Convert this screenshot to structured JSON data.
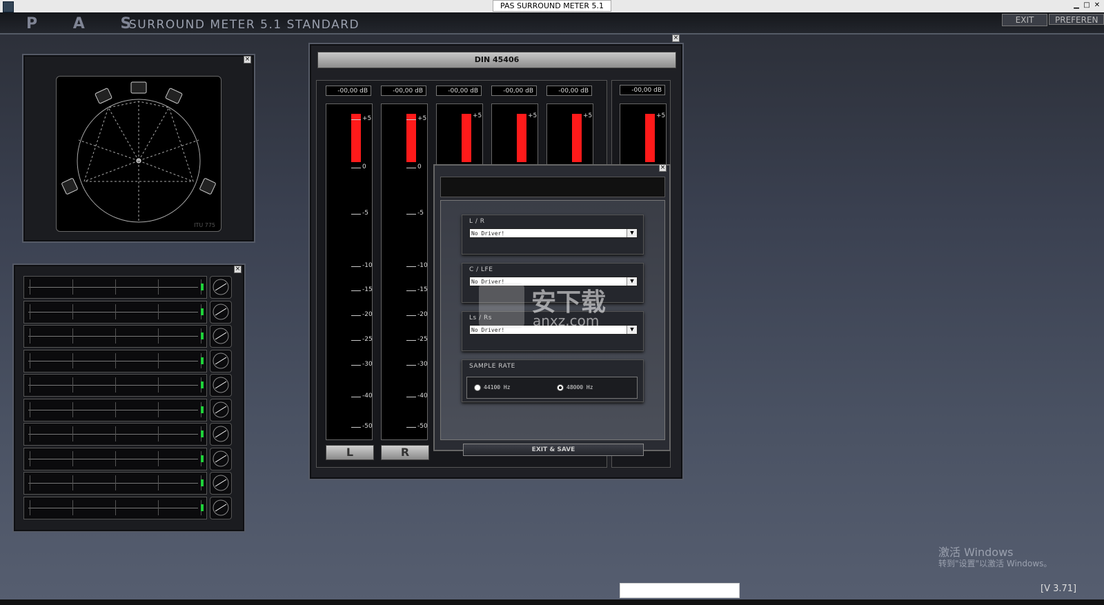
{
  "window": {
    "title": "PAS SURROUND METER 5.1"
  },
  "header": {
    "logo": "P A S",
    "product": "SURROUND METER  5.1 STANDARD",
    "exit_label": "EXIT",
    "preferences_label": "PREFEREN"
  },
  "speaker_panel": {
    "label": "ITU 775"
  },
  "meter_panel": {
    "standard": "DIN 45406",
    "readouts": [
      "-00,00 dB",
      "-00,00 dB",
      "-00,00 dB",
      "-00,00 dB",
      "-00,00 dB",
      "-00,00 dB"
    ],
    "scale_labels": [
      "+5",
      "0",
      "-5",
      "-10",
      "-15",
      "-20",
      "-25",
      "-30",
      "-40",
      "-50"
    ],
    "channel_buttons": [
      "L",
      "R"
    ]
  },
  "preferences": {
    "groups": [
      {
        "label": "L / R",
        "value": "No Driver!"
      },
      {
        "label": "C / LFE",
        "value": "No Driver!"
      },
      {
        "label": "Ls / Rs",
        "value": "No Driver!"
      }
    ],
    "sample_rate": {
      "label": "SAMPLE RATE",
      "options": [
        "44100  Hz",
        "48000  Hz"
      ],
      "selected": "48000  Hz"
    },
    "exit_save": "EXIT & SAVE"
  },
  "desktop": {
    "activate_title": "激活 Windows",
    "activate_sub": "转到\"设置\"以激活 Windows。",
    "version": "[V 3.71]"
  },
  "watermark": {
    "text": "安下载",
    "sub": "anxz.com"
  },
  "colors": {
    "meter_red": "#ff1a1a",
    "phase_green": "#1fd23a"
  }
}
